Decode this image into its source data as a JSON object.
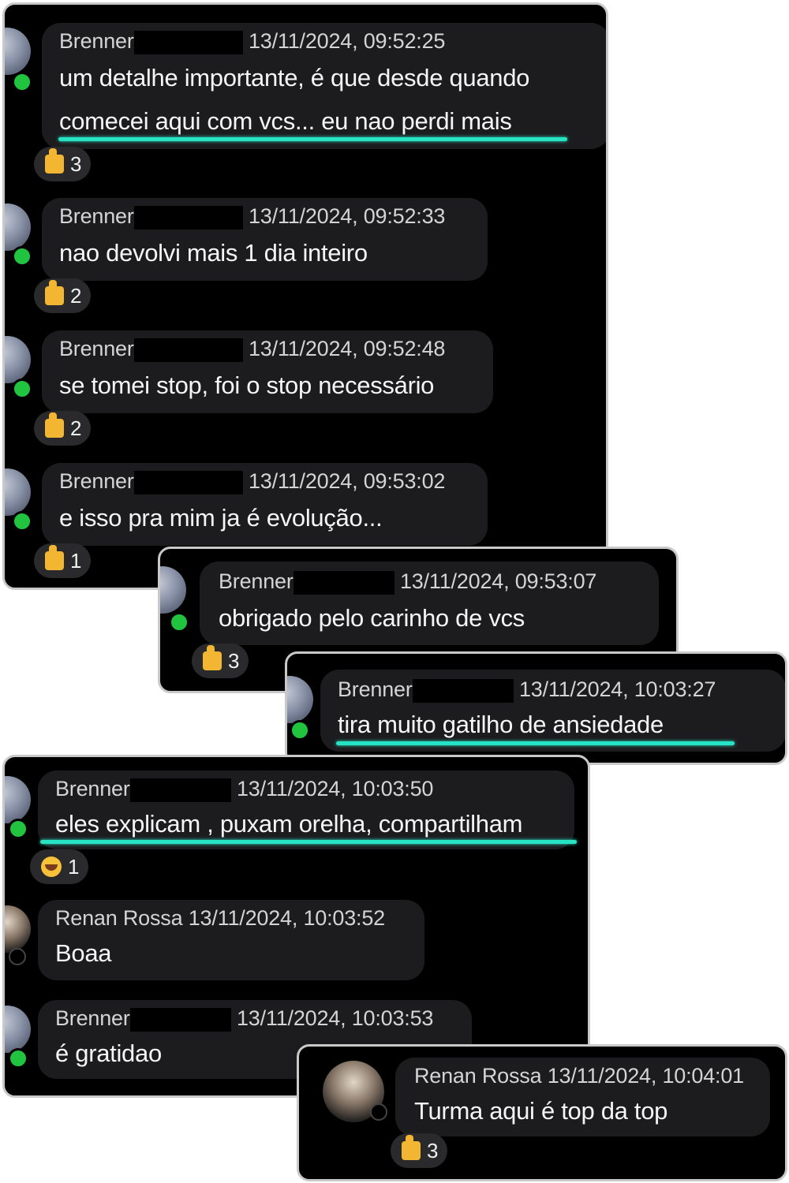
{
  "card1": {
    "messages": [
      {
        "author": "Brenner",
        "timestamp": "13/11/2024, 09:52:25",
        "lines": [
          "um detalhe importante, é que desde quando",
          "comecei aqui com vcs... eu nao perdi mais"
        ],
        "reaction_count": "3"
      },
      {
        "author": "Brenner",
        "timestamp": "13/11/2024, 09:52:33",
        "lines": [
          "nao devolvi mais 1 dia inteiro"
        ],
        "reaction_count": "2"
      },
      {
        "author": "Brenner",
        "timestamp": "13/11/2024, 09:52:48",
        "lines": [
          "se tomei stop, foi o stop necessário"
        ],
        "reaction_count": "2"
      },
      {
        "author": "Brenner",
        "timestamp": "13/11/2024, 09:53:02",
        "lines": [
          "e isso pra mim ja é evolução..."
        ],
        "reaction_count": "1"
      }
    ]
  },
  "card2": {
    "author": "Brenner",
    "timestamp": "13/11/2024, 09:53:07",
    "text": "obrigado pelo carinho de vcs",
    "reaction_count": "3"
  },
  "card3": {
    "author": "Brenner",
    "timestamp": "13/11/2024, 10:03:27",
    "text": "tira muito gatilho de ansiedade"
  },
  "card4": {
    "messages": [
      {
        "author": "Brenner",
        "timestamp": "13/11/2024, 10:03:50",
        "text": "eles explicam , puxam orelha, compartilham",
        "reaction_count": "1"
      },
      {
        "author": "Renan Rossa",
        "timestamp": "13/11/2024, 10:03:52",
        "text": "Boaa"
      },
      {
        "author": "Brenner",
        "timestamp": "13/11/2024, 10:03:53",
        "text": "é gratidao"
      }
    ]
  },
  "card5": {
    "author": "Renan Rossa",
    "timestamp": "13/11/2024, 10:04:01",
    "text": "Turma aqui é top da top",
    "reaction_count": "3"
  },
  "colors": {
    "highlight": "#27e3c4",
    "online": "#22c33f",
    "bubble": "#1c1c1e",
    "background": "#000000"
  }
}
